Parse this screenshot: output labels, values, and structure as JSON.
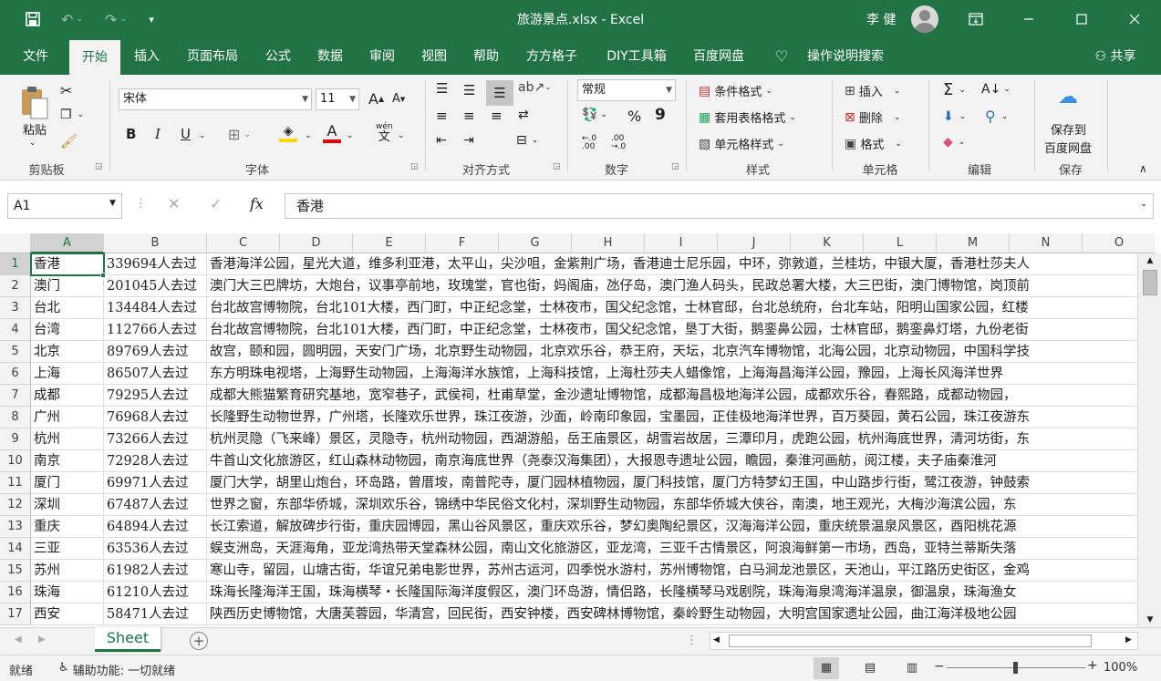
{
  "titlebar": {
    "title": "旅游景点.xlsx  -  Excel",
    "user": "李 健",
    "save_icon": "save-icon",
    "undo_icon": "undo-icon",
    "redo_icon": "redo-icon"
  },
  "tabs": [
    "文件",
    "开始",
    "插入",
    "页面布局",
    "公式",
    "数据",
    "审阅",
    "视图",
    "帮助",
    "方方格子",
    "DIY工具箱",
    "百度网盘",
    "操作说明搜索"
  ],
  "share": "共享",
  "ribbon": {
    "clipboard": {
      "paste": "粘贴",
      "label": "剪贴板"
    },
    "font": {
      "name": "宋体",
      "size": "11",
      "grow": "A",
      "shrink": "A",
      "bold": "B",
      "italic": "I",
      "underline": "U",
      "label": "字体",
      "wen": "wén"
    },
    "alignment": {
      "label": "对齐方式"
    },
    "number": {
      "format": "常规",
      "percent": "%",
      "comma": "9",
      "label": "数字",
      "inc": "←.0 .00",
      "dec": ".00 →.0"
    },
    "styles": {
      "conditional": "条件格式",
      "table": "套用表格格式",
      "cell": "单元格样式",
      "label": "样式"
    },
    "cells": {
      "insert": "插入",
      "delete": "删除",
      "format": "格式",
      "label": "单元格"
    },
    "editing": {
      "label": "编辑"
    },
    "save": {
      "line1": "保存到",
      "line2": "百度网盘",
      "label": "保存"
    }
  },
  "formula_bar": {
    "name_box": "A1",
    "content": "香港",
    "fx": "fx"
  },
  "columns": [
    "A",
    "B",
    "C",
    "D",
    "E",
    "F",
    "G",
    "H",
    "I",
    "J",
    "K",
    "L",
    "M",
    "N",
    "O"
  ],
  "rows": [
    {
      "n": "1",
      "a": "香港",
      "b": "339694人去过",
      "c": "香港海洋公园，星光大道，维多利亚港，太平山，尖沙咀，金紫荆广场，香港迪士尼乐园，中环，弥敦道，兰桂坊，中银大厦，香港杜莎夫人"
    },
    {
      "n": "2",
      "a": "澳门",
      "b": "201045人去过",
      "c": "澳门大三巴牌坊，大炮台，议事亭前地，玫瑰堂，官也街，妈阁庙，氹仔岛，澳门渔人码头，民政总署大楼，大三巴街，澳门博物馆，岗顶前"
    },
    {
      "n": "3",
      "a": "台北",
      "b": "134484人去过",
      "c": "台北故宫博物院，台北101大楼，西门町，中正纪念堂，士林夜市，国父纪念馆，士林官邸，台北总统府，台北车站，阳明山国家公园，红楼"
    },
    {
      "n": "4",
      "a": "台湾",
      "b": "112766人去过",
      "c": "台北故宫博物院，台北101大楼，西门町，中正纪念堂，士林夜市，国父纪念馆，垦丁大街，鹅銮鼻公园，士林官邸，鹅銮鼻灯塔，九份老街"
    },
    {
      "n": "5",
      "a": "北京",
      "b": "89769人去过",
      "c": "故宫，颐和园，圆明园，天安门广场，北京野生动物园，北京欢乐谷，恭王府，天坛，北京汽车博物馆，北海公园，北京动物园，中国科学技"
    },
    {
      "n": "6",
      "a": "上海",
      "b": "86507人去过",
      "c": "东方明珠电视塔，上海野生动物园，上海海洋水族馆，上海科技馆，上海杜莎夫人蜡像馆，上海海昌海洋公园，豫园，上海长风海洋世界"
    },
    {
      "n": "7",
      "a": "成都",
      "b": "79295人去过",
      "c": "成都大熊猫繁育研究基地，宽窄巷子，武侯祠，杜甫草堂，金沙遗址博物馆，成都海昌极地海洋公园，成都欢乐谷，春熙路，成都动物园，"
    },
    {
      "n": "8",
      "a": "广州",
      "b": "76968人去过",
      "c": "长隆野生动物世界，广州塔，长隆欢乐世界，珠江夜游，沙面，岭南印象园，宝墨园，正佳极地海洋世界，百万葵园，黄石公园，珠江夜游东"
    },
    {
      "n": "9",
      "a": "杭州",
      "b": "73266人去过",
      "c": "杭州灵隐（飞来峰）景区，灵隐寺，杭州动物园，西湖游船，岳王庙景区，胡雪岩故居，三潭印月，虎跑公园，杭州海底世界，清河坊街，东"
    },
    {
      "n": "10",
      "a": "南京",
      "b": "72928人去过",
      "c": "牛首山文化旅游区，红山森林动物园，南京海底世界（尧泰汉海集团），大报恩寺遗址公园，瞻园，秦淮河画舫，阅江楼，夫子庙秦淮河"
    },
    {
      "n": "11",
      "a": "厦门",
      "b": "69971人去过",
      "c": "厦门大学，胡里山炮台，环岛路，曾厝垵，南普陀寺，厦门园林植物园，厦门科技馆，厦门方特梦幻王国，中山路步行街，鹭江夜游，钟鼓索"
    },
    {
      "n": "12",
      "a": "深圳",
      "b": "67487人去过",
      "c": "世界之窗，东部华侨城，深圳欢乐谷，锦绣中华民俗文化村，深圳野生动物园，东部华侨城大侠谷，南澳，地王观光，大梅沙海滨公园，东"
    },
    {
      "n": "13",
      "a": "重庆",
      "b": "64894人去过",
      "c": "长江索道，解放碑步行街，重庆园博园，黑山谷风景区，重庆欢乐谷，梦幻奥陶纪景区，汉海海洋公园，重庆统景温泉风景区，酉阳桃花源"
    },
    {
      "n": "14",
      "a": "三亚",
      "b": "63536人去过",
      "c": "蜈支洲岛，天涯海角，亚龙湾热带天堂森林公园，南山文化旅游区，亚龙湾，三亚千古情景区，阿浪海鲜第一市场，西岛，亚特兰蒂斯失落"
    },
    {
      "n": "15",
      "a": "苏州",
      "b": "61982人去过",
      "c": "寒山寺，留园，山塘古街，华谊兄弟电影世界，苏州古运河，四季悦水游村，苏州博物馆，白马涧龙池景区，天池山，平江路历史街区，金鸡"
    },
    {
      "n": "16",
      "a": "珠海",
      "b": "61210人去过",
      "c": "珠海长隆海洋王国，珠海横琴・长隆国际海洋度假区，澳门环岛游，情侣路，长隆横琴马戏剧院，珠海海泉湾海洋温泉，御温泉，珠海渔女"
    },
    {
      "n": "17",
      "a": "西安",
      "b": "58471人去过",
      "c": "陕西历史博物馆，大唐芙蓉园，华清宫，回民街，西安钟楼，西安碑林博物馆，秦岭野生动物园，大明宫国家遗址公园，曲江海洋极地公园"
    }
  ],
  "sheet_tab": "Sheet",
  "status": {
    "ready": "就绪",
    "accessibility": "辅助功能: 一切就绪",
    "zoom": "100%"
  }
}
